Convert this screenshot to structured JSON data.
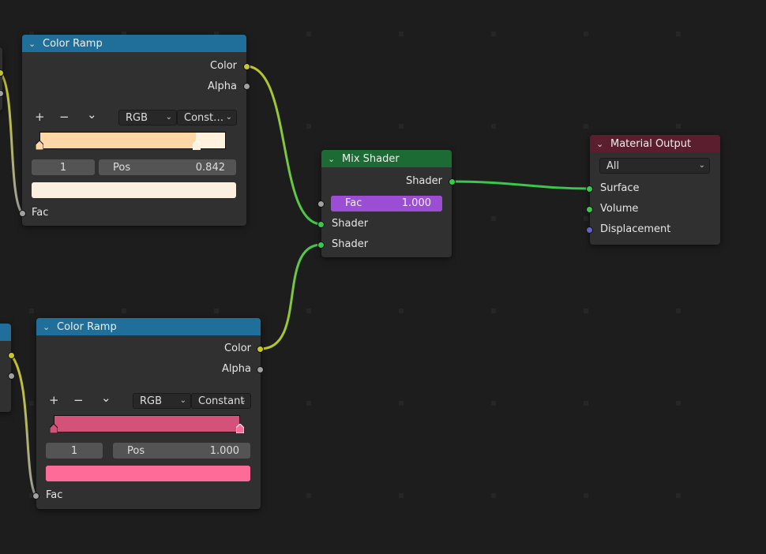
{
  "editor": {
    "background": "#1d1d1d"
  },
  "color_ramp_1": {
    "title": "Color Ramp",
    "outputs": {
      "color": "Color",
      "alpha": "Alpha"
    },
    "toolbar": {
      "add": "+",
      "remove": "−",
      "menu": "⌄"
    },
    "color_mode": "RGB",
    "interpolation": "Const…",
    "stop_colors": [
      "#ffd7a6",
      "#fff1de"
    ],
    "stop_positions": [
      0.0,
      0.842
    ],
    "active_index": "1",
    "pos_label": "Pos",
    "pos_value": "0.842",
    "active_color": "#fbf0e0",
    "input_fac": "Fac"
  },
  "color_ramp_2": {
    "title": "Color Ramp",
    "outputs": {
      "color": "Color",
      "alpha": "Alpha"
    },
    "toolbar": {
      "add": "+",
      "remove": "−",
      "menu": "⌄"
    },
    "color_mode": "RGB",
    "interpolation": "Constant",
    "stop_colors": [
      "#d4527a",
      "#ff6b98"
    ],
    "stop_positions": [
      0.0,
      1.0
    ],
    "active_index": "1",
    "pos_label": "Pos",
    "pos_value": "1.000",
    "active_color": "#ff6b98",
    "input_fac": "Fac"
  },
  "mix_shader": {
    "title": "Mix Shader",
    "output": "Shader",
    "fac_label": "Fac",
    "fac_value": "1.000",
    "fac_fraction": 1.0,
    "input_shader_1": "Shader",
    "input_shader_2": "Shader"
  },
  "material_output": {
    "title": "Material Output",
    "target": "All",
    "inputs": {
      "surface": "Surface",
      "volume": "Volume",
      "displacement": "Displacement"
    }
  }
}
